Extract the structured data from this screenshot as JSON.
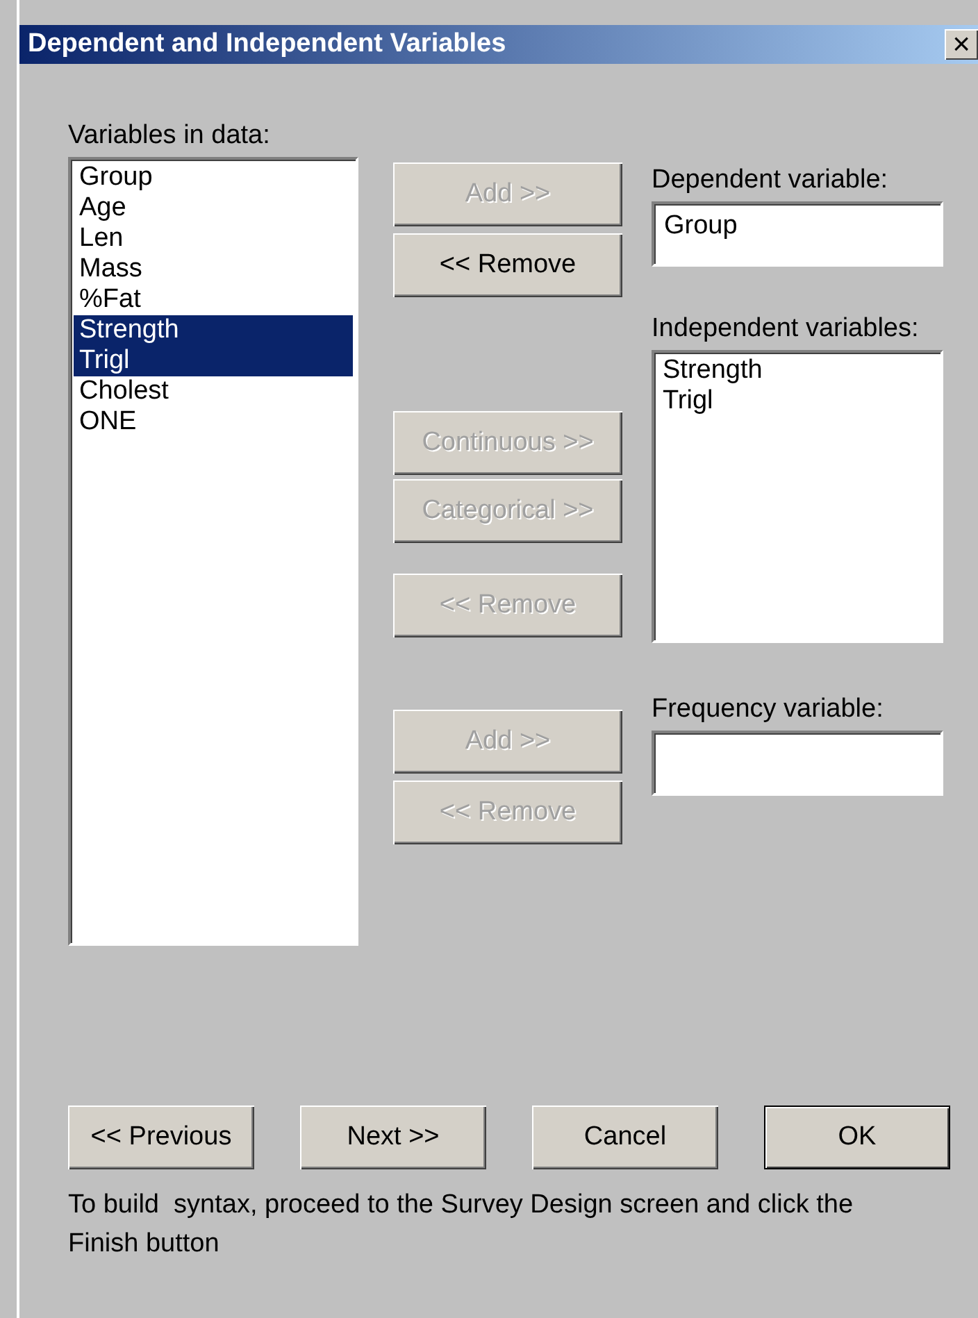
{
  "window": {
    "title": "Dependent and Independent Variables",
    "close_label": "×"
  },
  "variables": {
    "label": "Variables in data:",
    "items": [
      {
        "name": "Group",
        "selected": false
      },
      {
        "name": "Age",
        "selected": false
      },
      {
        "name": "Len",
        "selected": false
      },
      {
        "name": "Mass",
        "selected": false
      },
      {
        "name": "%Fat",
        "selected": false
      },
      {
        "name": "Strength",
        "selected": true
      },
      {
        "name": "Trigl",
        "selected": true
      },
      {
        "name": "Cholest",
        "selected": false
      },
      {
        "name": "ONE",
        "selected": false
      }
    ]
  },
  "dependent": {
    "buttons": [
      {
        "label": "Add >>",
        "disabled": true
      },
      {
        "label": "<< Remove",
        "disabled": false
      }
    ],
    "label": "Dependent variable:",
    "value": "Group"
  },
  "independent": {
    "buttons": [
      {
        "label": "Continuous >>",
        "disabled": true
      },
      {
        "label": "Categorical >>",
        "disabled": true
      },
      {
        "label": "<< Remove",
        "disabled": true
      }
    ],
    "label": "Independent variables:",
    "items": [
      "Strength",
      "Trigl"
    ]
  },
  "frequency": {
    "buttons": [
      {
        "label": "Add >>",
        "disabled": true
      },
      {
        "label": "<< Remove",
        "disabled": true
      }
    ],
    "label": "Frequency variable:"
  },
  "footer_buttons": [
    {
      "label": "<< Previous",
      "default": false
    },
    {
      "label": "Next >>",
      "default": false
    },
    {
      "label": "Cancel",
      "default": false
    },
    {
      "label": "OK",
      "default": true
    }
  ],
  "note": "To build  syntax, proceed to the Survey Design screen and click the Finish button"
}
